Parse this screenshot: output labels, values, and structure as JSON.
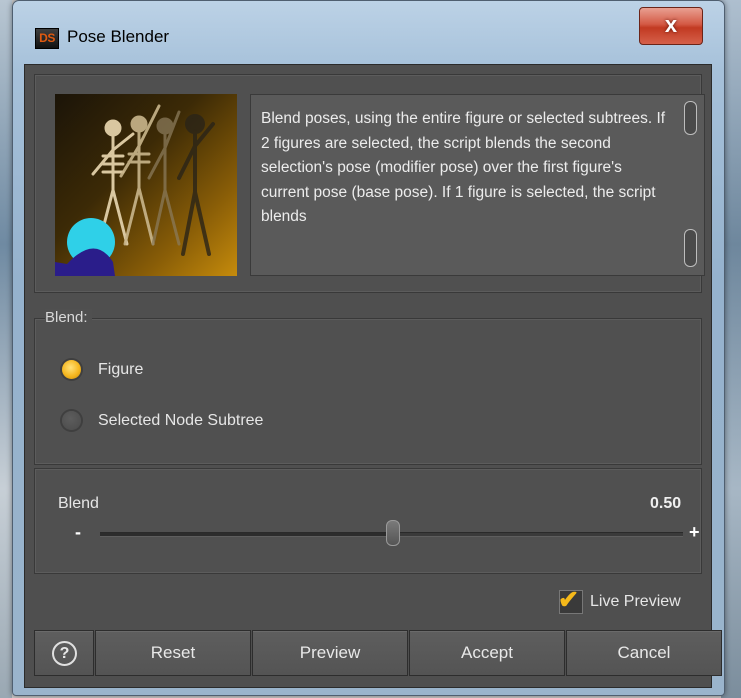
{
  "window": {
    "app_icon_text": "DS",
    "title": "Pose Blender",
    "close_label": "x"
  },
  "description": "Blend poses, using the entire figure or selected subtrees.  If 2 figures are selected, the script blends the second selection's pose (modifier pose) over the first figure's current pose (base pose).  If 1 figure is selected, the script blends",
  "blend_group": {
    "legend": "Blend:",
    "options": [
      {
        "label": "Figure",
        "selected": true
      },
      {
        "label": "Selected Node Subtree",
        "selected": false
      }
    ]
  },
  "slider": {
    "label": "Blend",
    "value_text": "0.50",
    "value": 0.5,
    "min_symbol": "-",
    "max_symbol": "+"
  },
  "live_preview": {
    "label": "Live Preview",
    "checked": true
  },
  "buttons": {
    "help": "?",
    "reset": "Reset",
    "preview": "Preview",
    "accept": "Accept",
    "cancel": "Cancel"
  },
  "colors": {
    "accent": "#f5b720",
    "panel_bg": "#505050",
    "close_red": "#c23a22"
  }
}
